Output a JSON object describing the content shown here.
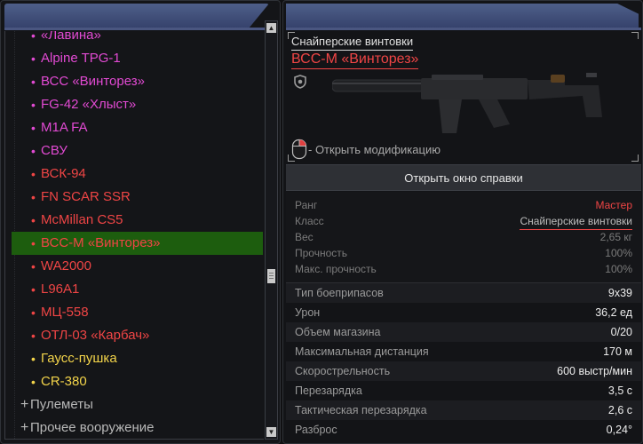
{
  "weapon_list": {
    "items": [
      {
        "label": "«Лавина»",
        "color": "pink"
      },
      {
        "label": "Alpine TPG-1",
        "color": "pink"
      },
      {
        "label": "ВСС «Винторез»",
        "color": "pink"
      },
      {
        "label": "FG-42 «Хлыст»",
        "color": "pink"
      },
      {
        "label": "M1A FA",
        "color": "pink"
      },
      {
        "label": "СВУ",
        "color": "pink"
      },
      {
        "label": "ВСК-94",
        "color": "red"
      },
      {
        "label": "FN SCAR SSR",
        "color": "red"
      },
      {
        "label": "McMillan CS5",
        "color": "red"
      },
      {
        "label": "ВСС-М «Винторез»",
        "color": "red",
        "selected": true
      },
      {
        "label": "WA2000",
        "color": "red"
      },
      {
        "label": "L96A1",
        "color": "red"
      },
      {
        "label": "МЦ-558",
        "color": "red"
      },
      {
        "label": "ОТЛ-03 «Карбач»",
        "color": "red"
      },
      {
        "label": "Гаусс-пушка",
        "color": "yellow"
      },
      {
        "label": "CR-380",
        "color": "yellow"
      }
    ],
    "groups": [
      {
        "label": "Пулеметы"
      },
      {
        "label": "Прочее вооружение"
      }
    ]
  },
  "colors": {
    "pink": "#e24ad3",
    "red": "#ef4545",
    "yellow": "#f3d44a",
    "selected_bg": "#1d5d0e",
    "header": "#4e5f89"
  },
  "details": {
    "category": "Снайперские винтовки",
    "weapon_name": "ВСС-М «Винторез»",
    "modify_hint": "- Открыть модификацию",
    "help_button": "Открыть окно справки",
    "info": {
      "rank_label": "Ранг",
      "rank_value": "Мастер",
      "class_label": "Класс",
      "class_value": "Снайперские винтовки",
      "weight_label": "Вес",
      "weight_value": "2,65 кг",
      "durability_label": "Прочность",
      "durability_value": "100%",
      "max_durability_label": "Макс. прочность",
      "max_durability_value": "100%"
    },
    "properties": [
      {
        "label": "Тип боеприпасов",
        "value": "9x39"
      },
      {
        "label": "Урон",
        "value": "36,2 ед"
      },
      {
        "label": "Объем магазина",
        "value": "0/20"
      },
      {
        "label": "Максимальная дистанция",
        "value": "170 м"
      },
      {
        "label": "Скорострельность",
        "value": "600 выстр/мин"
      },
      {
        "label": "Перезарядка",
        "value": "3,5 с"
      },
      {
        "label": "Тактическая перезарядка",
        "value": "2,6 с"
      },
      {
        "label": "Разброс",
        "value": "0,24°"
      }
    ]
  }
}
